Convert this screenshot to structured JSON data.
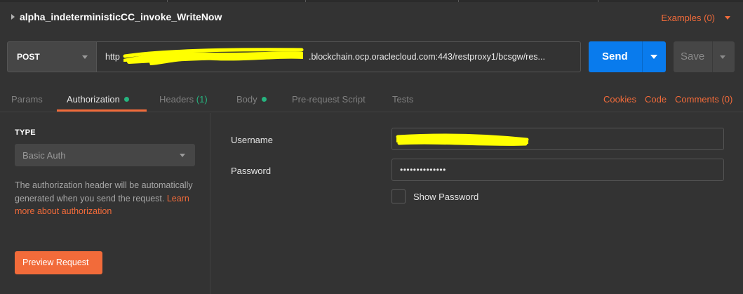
{
  "request": {
    "title": "alpha_indeterministicCC_invoke_WriteNow",
    "examples_label": "Examples (0)"
  },
  "url_bar": {
    "method": "POST",
    "url_prefix": "http",
    "url_visible": ".blockchain.ocp.oraclecloud.com:443/restproxy1/bcsgw/res...",
    "send_label": "Send",
    "save_label": "Save"
  },
  "tabs": [
    {
      "label": "Params"
    },
    {
      "label": "Authorization",
      "dot": true
    },
    {
      "label": "Headers",
      "count": "(1)"
    },
    {
      "label": "Body",
      "dot": true
    },
    {
      "label": "Pre-request Script"
    },
    {
      "label": "Tests"
    }
  ],
  "right_links": {
    "cookies": "Cookies",
    "code": "Code",
    "comments": "Comments (0)"
  },
  "auth": {
    "type_label": "TYPE",
    "type_value": "Basic Auth",
    "help_text": "The authorization header will be automatically generated when you send the request. ",
    "help_link": "Learn more about authorization",
    "preview_label": "Preview Request",
    "username_label": "Username",
    "password_label": "Password",
    "password_value": "••••••••••••••",
    "show_password_label": "Show Password"
  },
  "colors": {
    "accent": "#f26b3a",
    "send": "#097bed",
    "indicator": "#26b47f",
    "redaction": "#ffff00"
  }
}
